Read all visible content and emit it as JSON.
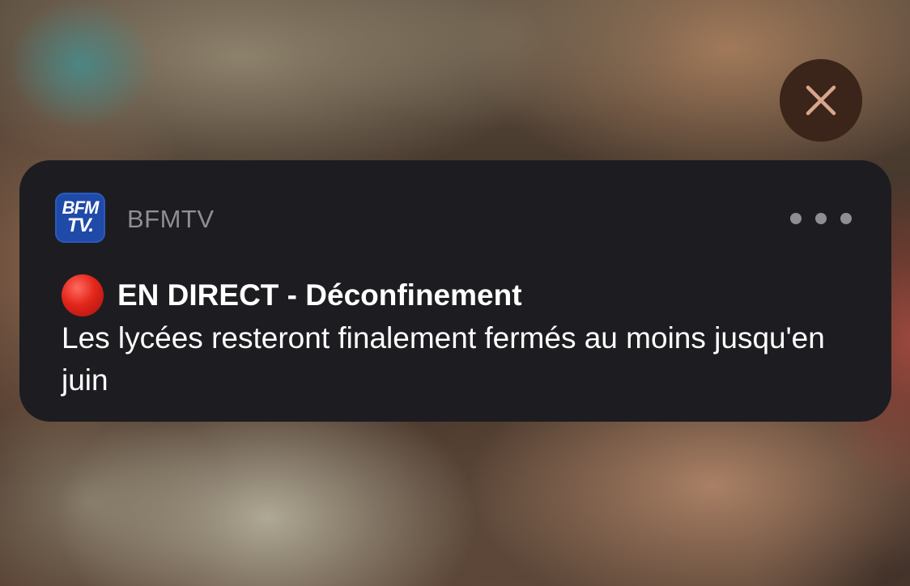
{
  "close_button": {
    "icon": "close-icon"
  },
  "notification": {
    "app_icon": {
      "line1": "BFM",
      "line2": "TV."
    },
    "app_name": "BFMTV",
    "more_icon": "ellipsis-icon",
    "title_icon": "red-circle-icon",
    "title": "EN DIRECT - Déconfinement",
    "body": "Les lycées resteront finalement fermés au moins jusqu'en juin"
  },
  "colors": {
    "card_background": "#1d1d21",
    "app_name": "#8e8e93",
    "text": "#ffffff",
    "brand_blue": "#1f4aa8",
    "live_red": "#e3261b",
    "close_button_background": "#3b2419"
  }
}
